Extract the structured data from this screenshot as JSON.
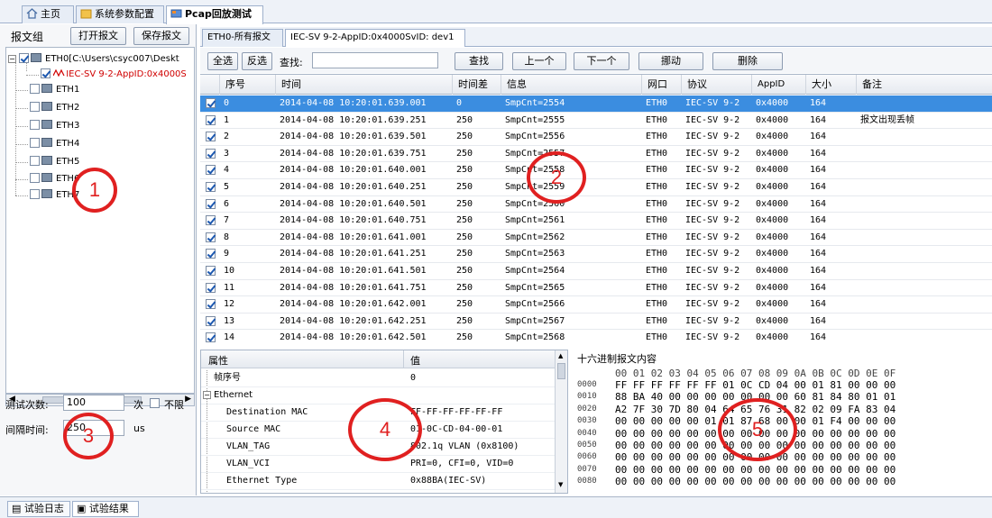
{
  "top_tabs": [
    "主页",
    "系统参数配置",
    "Pcap回放测试"
  ],
  "left": {
    "title": "报文组",
    "open_label": "打开报文",
    "save_label": "保存报文",
    "tree": [
      {
        "label": "ETH0[C:\\Users\\csyc007\\Deskt",
        "checked": true
      },
      {
        "label": "IEC-SV 9-2-AppID:0x4000S",
        "checked": true
      },
      {
        "label": "ETH1",
        "checked": false
      },
      {
        "label": "ETH2",
        "checked": false
      },
      {
        "label": "ETH3",
        "checked": false
      },
      {
        "label": "ETH4",
        "checked": false
      },
      {
        "label": "ETH5",
        "checked": false
      },
      {
        "label": "ETH6",
        "checked": false
      },
      {
        "label": "ETH7",
        "checked": false
      }
    ],
    "test_count_label": "测试次数:",
    "test_count_value": "100",
    "test_count_unit": "次",
    "unlimited_label": "不限",
    "interval_label": "间隔时间:",
    "interval_value": "250",
    "interval_unit": "us"
  },
  "right_tabs": [
    "ETH0-所有报文",
    "IEC-SV 9-2-AppID:0x4000SvID: dev1"
  ],
  "toolbar": {
    "select_all": "全选",
    "invert": "反选",
    "search_label": "查找:",
    "search_value": "",
    "find": "查找",
    "prev": "上一个",
    "next": "下一个",
    "move": "挪动",
    "delete": "删除"
  },
  "grid": {
    "columns": [
      "序号",
      "时间",
      "时间差",
      "信息",
      "网口",
      "协议",
      "AppID",
      "大小",
      "备注"
    ],
    "rows": [
      [
        "0",
        "2014-04-08 10:20:01.639.001",
        "0",
        "SmpCnt=2554",
        "ETH0",
        "IEC-SV 9-2",
        "0x4000",
        "164",
        ""
      ],
      [
        "1",
        "2014-04-08 10:20:01.639.251",
        "250",
        "SmpCnt=2555",
        "ETH0",
        "IEC-SV 9-2",
        "0x4000",
        "164",
        "报文出现丢帧"
      ],
      [
        "2",
        "2014-04-08 10:20:01.639.501",
        "250",
        "SmpCnt=2556",
        "ETH0",
        "IEC-SV 9-2",
        "0x4000",
        "164",
        ""
      ],
      [
        "3",
        "2014-04-08 10:20:01.639.751",
        "250",
        "SmpCnt=2557",
        "ETH0",
        "IEC-SV 9-2",
        "0x4000",
        "164",
        ""
      ],
      [
        "4",
        "2014-04-08 10:20:01.640.001",
        "250",
        "SmpCnt=2558",
        "ETH0",
        "IEC-SV 9-2",
        "0x4000",
        "164",
        ""
      ],
      [
        "5",
        "2014-04-08 10:20:01.640.251",
        "250",
        "SmpCnt=2559",
        "ETH0",
        "IEC-SV 9-2",
        "0x4000",
        "164",
        ""
      ],
      [
        "6",
        "2014-04-08 10:20:01.640.501",
        "250",
        "SmpCnt=2560",
        "ETH0",
        "IEC-SV 9-2",
        "0x4000",
        "164",
        ""
      ],
      [
        "7",
        "2014-04-08 10:20:01.640.751",
        "250",
        "SmpCnt=2561",
        "ETH0",
        "IEC-SV 9-2",
        "0x4000",
        "164",
        ""
      ],
      [
        "8",
        "2014-04-08 10:20:01.641.001",
        "250",
        "SmpCnt=2562",
        "ETH0",
        "IEC-SV 9-2",
        "0x4000",
        "164",
        ""
      ],
      [
        "9",
        "2014-04-08 10:20:01.641.251",
        "250",
        "SmpCnt=2563",
        "ETH0",
        "IEC-SV 9-2",
        "0x4000",
        "164",
        ""
      ],
      [
        "10",
        "2014-04-08 10:20:01.641.501",
        "250",
        "SmpCnt=2564",
        "ETH0",
        "IEC-SV 9-2",
        "0x4000",
        "164",
        ""
      ],
      [
        "11",
        "2014-04-08 10:20:01.641.751",
        "250",
        "SmpCnt=2565",
        "ETH0",
        "IEC-SV 9-2",
        "0x4000",
        "164",
        ""
      ],
      [
        "12",
        "2014-04-08 10:20:01.642.001",
        "250",
        "SmpCnt=2566",
        "ETH0",
        "IEC-SV 9-2",
        "0x4000",
        "164",
        ""
      ],
      [
        "13",
        "2014-04-08 10:20:01.642.251",
        "250",
        "SmpCnt=2567",
        "ETH0",
        "IEC-SV 9-2",
        "0x4000",
        "164",
        ""
      ],
      [
        "14",
        "2014-04-08 10:20:01.642.501",
        "250",
        "SmpCnt=2568",
        "ETH0",
        "IEC-SV 9-2",
        "0x4000",
        "164",
        ""
      ]
    ]
  },
  "props": {
    "col_attr": "属性",
    "col_value": "值",
    "rows": [
      {
        "name": "帧序号",
        "value": "0"
      },
      {
        "name": "Ethernet",
        "value": ""
      },
      {
        "name": "Destination MAC",
        "value": "FF-FF-FF-FF-FF-FF"
      },
      {
        "name": "Source MAC",
        "value": "01-0C-CD-04-00-01"
      },
      {
        "name": "VLAN_TAG",
        "value": "802.1q VLAN (0x8100)"
      },
      {
        "name": "VLAN_VCI",
        "value": "PRI=0, CFI=0, VID=0"
      },
      {
        "name": "Ethernet Type",
        "value": "0x88BA(IEC-SV)"
      }
    ]
  },
  "hex": {
    "title": "十六进制报文内容",
    "header": "00 01 02 03 04 05 06 07 08 09 0A 0B 0C 0D 0E 0F",
    "rows": [
      {
        "addr": "0000",
        "bytes": "FF FF FF FF FF FF 01 0C CD 04 00 01 81 00 00 00"
      },
      {
        "addr": "0010",
        "bytes": "88 BA 40 00 00 00 00 00 00 00 60 81 84 80 01 01"
      },
      {
        "addr": "0020",
        "bytes": "A2 7F 30 7D 80 04 64 65 76 31 82 02 09 FA 83 04"
      },
      {
        "addr": "0030",
        "bytes": "00 00 00 00 00 01 01 87 68 00 00 01 F4 00 00 00"
      },
      {
        "addr": "0040",
        "bytes": "00 00 00 00 00 00 00 00 00 00 00 00 00 00 00 00"
      },
      {
        "addr": "0050",
        "bytes": "00 00 00 00 00 00 00 00 00 00 00 00 00 00 00 00"
      },
      {
        "addr": "0060",
        "bytes": "00 00 00 00 00 00 00 00 00 00 00 00 00 00 00 00"
      },
      {
        "addr": "0070",
        "bytes": "00 00 00 00 00 00 00 00 00 00 00 00 00 00 00 00"
      },
      {
        "addr": "0080",
        "bytes": "00 00 00 00 00 00 00 00 00 00 00 00 00 00 00 00"
      }
    ]
  },
  "status_tabs": [
    "试验日志",
    "试验结果"
  ],
  "annotations": [
    "1",
    "2",
    "3",
    "4",
    "5"
  ],
  "colors": {
    "accent": "#3b8de0",
    "annotation": "#e02020",
    "tree_red": "#d00000"
  }
}
